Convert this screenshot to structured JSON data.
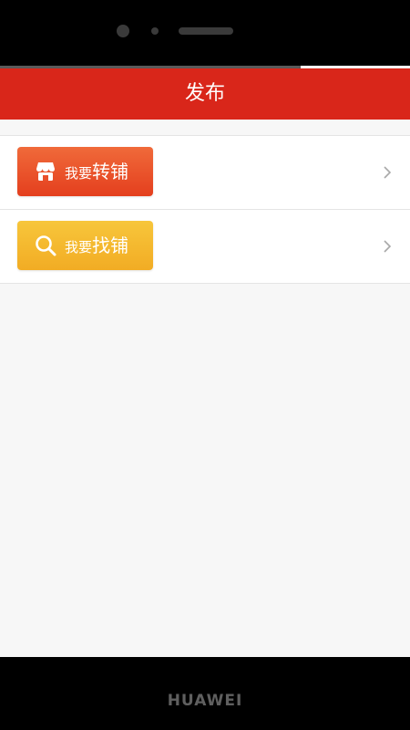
{
  "device": {
    "brand": "HUAWEI"
  },
  "header": {
    "title": "发布"
  },
  "options": [
    {
      "small": "我要",
      "big": "转铺",
      "icon": "shop-icon",
      "color": "#e9502b"
    },
    {
      "small": "我要",
      "big": "找铺",
      "icon": "search-icon",
      "color": "#f4b730"
    }
  ],
  "colors": {
    "accent": "#d9261a",
    "background": "#f7f7f7"
  }
}
